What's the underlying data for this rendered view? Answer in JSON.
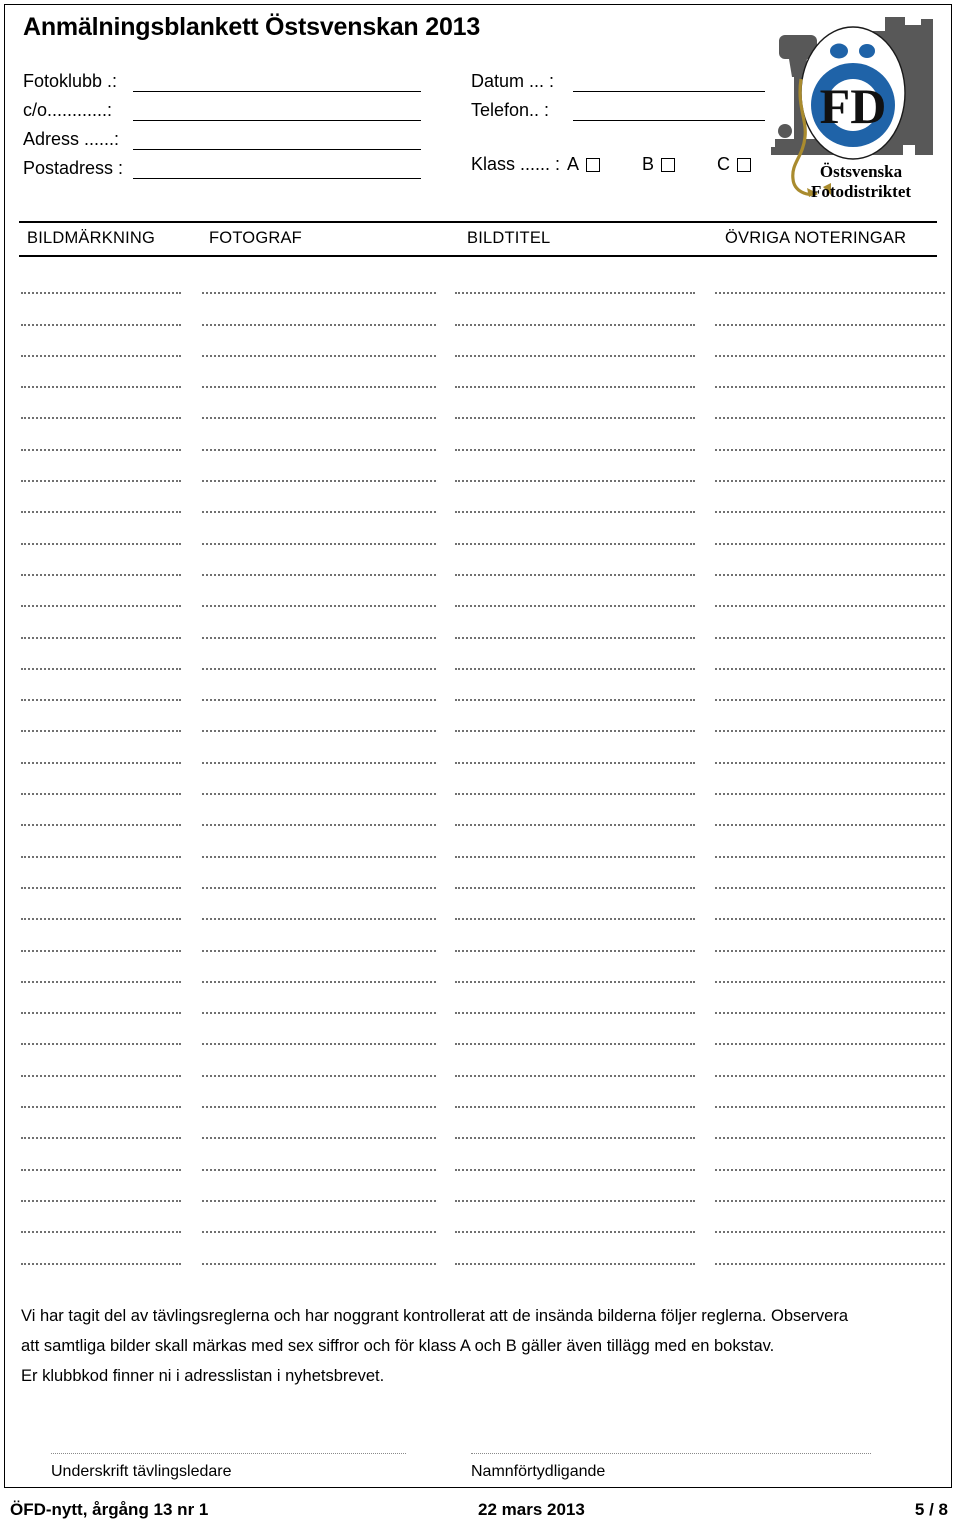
{
  "document": {
    "title": "Anmälningsblankett Östsvenskan 2013"
  },
  "form": {
    "left_fields": [
      {
        "label": "Fotoklubb .:",
        "value": ""
      },
      {
        "label": "c/o............:",
        "value": ""
      },
      {
        "label": "Adress ......:",
        "value": ""
      },
      {
        "label": "Postadress :",
        "value": ""
      }
    ],
    "right_fields": [
      {
        "label": "Datum ... :",
        "value": ""
      },
      {
        "label": "Telefon.. :",
        "value": ""
      }
    ],
    "class_row": {
      "label": "Klass ...... :",
      "options": [
        {
          "label": "A",
          "checked": false
        },
        {
          "label": "B",
          "checked": false
        },
        {
          "label": "C",
          "checked": false
        }
      ]
    }
  },
  "logo": {
    "mark_text": "FD",
    "name_line_1": "Östsvenska",
    "name_line_2": "Fotodistriktet",
    "colors": {
      "blue": "#1f63a8",
      "silhouette": "#585858",
      "cable": "#a98b2e",
      "text": "#000000"
    }
  },
  "table": {
    "columns": [
      "BILDMÄRKNING",
      "FOTOGRAF",
      "BILDTITEL",
      "ÖVRIGA NOTERINGAR"
    ],
    "row_count": 32,
    "rows_are_blank": true
  },
  "declaration": {
    "lines": [
      "Vi har tagit del av tävlingsreglerna och har noggrant kontrollerat att de insända bilderna följer reglerna. Observera",
      "att samtliga bilder skall märkas med sex siffror och för klass A och B gäller även tillägg med en bokstav.",
      "Er klubbkod finner ni i adresslistan i nyhetsbrevet."
    ]
  },
  "signatures": [
    {
      "caption": "Underskrift tävlingsledare",
      "value": ""
    },
    {
      "caption": "Namnförtydligande",
      "value": ""
    }
  ],
  "footer": {
    "left": "ÖFD-nytt, årgång 13 nr 1",
    "center": "22 mars 2013",
    "right": "5 / 8"
  }
}
